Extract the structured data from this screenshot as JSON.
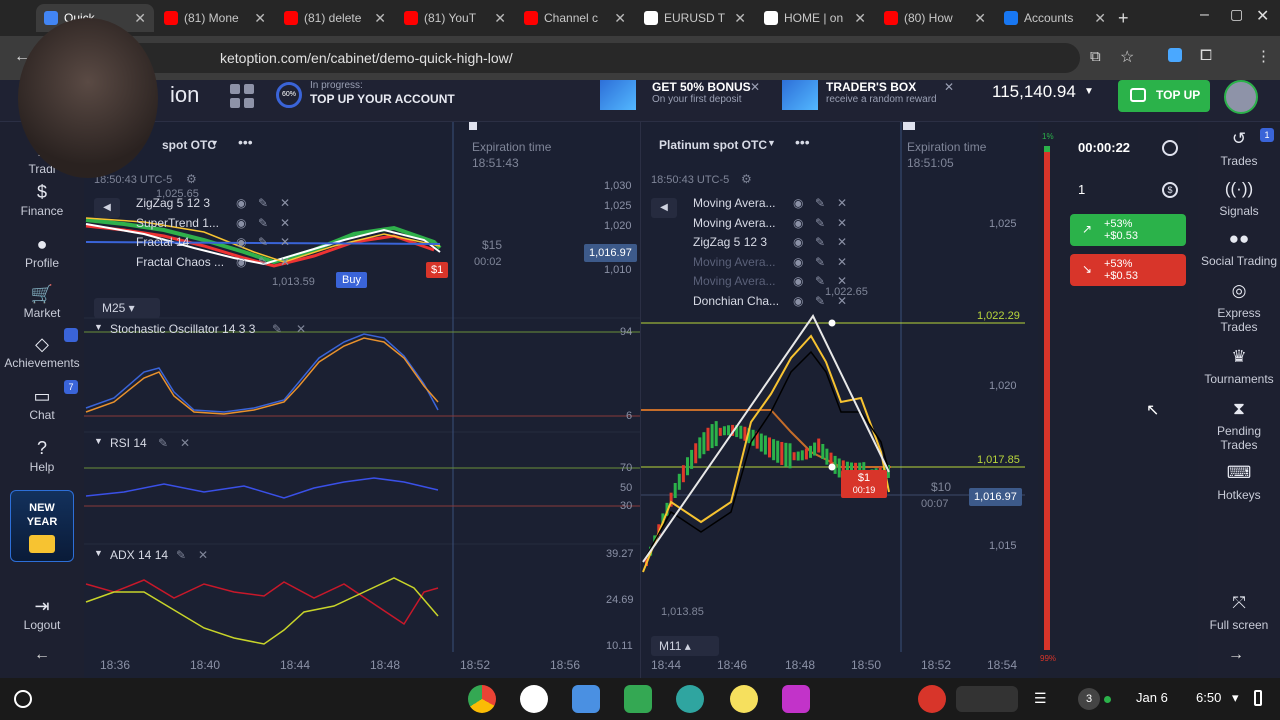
{
  "browser": {
    "tabs": [
      {
        "title": "Quick",
        "color": "#4285f4"
      },
      {
        "title": "(81) Mone",
        "color": "#ff0000"
      },
      {
        "title": "(81) delete",
        "color": "#ff0000"
      },
      {
        "title": "(81) YouT",
        "color": "#ff0000"
      },
      {
        "title": "Channel c",
        "color": "#ff0000"
      },
      {
        "title": "EURUSD T",
        "color": "#ffffff"
      },
      {
        "title": "HOME | on",
        "color": "#ffffff"
      },
      {
        "title": "(80) How",
        "color": "#ff0000"
      },
      {
        "title": "Accounts",
        "color": "#1877f2"
      }
    ],
    "url": "ketoption.com/en/cabinet/demo-quick-high-low/"
  },
  "header": {
    "logo_tail": "ion",
    "progress_pct": "60%",
    "progress_label": "In progress:",
    "progress_title": "TOP UP YOUR ACCOUNT",
    "promo1_title": "GET 50% BONUS",
    "promo1_sub": "On your first deposit",
    "promo2_title": "TRADER'S BOX",
    "promo2_sub": "receive a random reward",
    "balance": "115,140.94",
    "topup": "TOP UP"
  },
  "left_sidebar": {
    "items": [
      {
        "label": "Tradi",
        "icon": "trade-icon"
      },
      {
        "label": "Finance",
        "icon": "dollar-icon"
      },
      {
        "label": "Profile",
        "icon": "user-icon"
      },
      {
        "label": "Market",
        "icon": "cart-icon"
      },
      {
        "label": "Achievements",
        "icon": "diamond-icon"
      },
      {
        "label": "Chat",
        "icon": "chat-icon"
      },
      {
        "label": "Help",
        "icon": "help-icon"
      }
    ],
    "chat_badge": "7",
    "promo_line1": "NEW",
    "promo_line2": "YEAR",
    "logout": "Logout"
  },
  "chart_left": {
    "asset": "spot OTC",
    "time": "18:50:43 UTC-5",
    "exp_label": "Expiration time",
    "exp_time": "18:51:43",
    "indicators": [
      "ZigZag 5 12 3",
      "SuperTrend 1...",
      "Fractal 14",
      "Fractal Chaos ..."
    ],
    "price_axis": [
      "1,030",
      "1,025",
      "1,020",
      "1,010"
    ],
    "current_price": "1,016.97",
    "low_price": "1,013.59",
    "top_price": "1,025.65",
    "buy": "Buy",
    "trade_amount": "$15",
    "trade_timer": "00:02",
    "badge": "$1",
    "timeframe": "M25",
    "stoch_label": "Stochastic Oscillator 14 3 3",
    "stoch_axis": [
      "94",
      "6"
    ],
    "rsi_label": "RSI 14",
    "rsi_axis": [
      "70",
      "50",
      "30"
    ],
    "adx_label": "ADX 14 14",
    "adx_axis": [
      "39.27",
      "24.69",
      "10.11"
    ],
    "time_axis": [
      "18:36",
      "18:40",
      "18:44",
      "18:48",
      "18:52",
      "18:56"
    ]
  },
  "chart_right": {
    "asset": "Platinum spot OTC",
    "time": "18:50:43 UTC-5",
    "exp_label": "Expiration time",
    "exp_time": "18:51:05",
    "indicators": [
      "Moving Avera...",
      "Moving Avera...",
      "ZigZag 5 12 3",
      "Moving Avera...",
      "Moving Avera...",
      "Donchian Cha..."
    ],
    "price_axis": [
      "1,025",
      "1,020",
      "1,015"
    ],
    "high_line": "1,022.29",
    "high_label": "1,022.65",
    "mid_line": "1,017.85",
    "current_price": "1,016.97",
    "low_label": "1,013.85",
    "trade_amount": "$10",
    "trade_timer": "00:07",
    "badge": "$1",
    "badge_timer": "00:19",
    "timeframe": "M11",
    "time_axis": [
      "18:44",
      "18:46",
      "18:48",
      "18:50",
      "18:52",
      "18:54"
    ]
  },
  "trade_panel": {
    "timer": "00:00:22",
    "amount": "1",
    "up_pct": "+53%",
    "up_amt": "+$0.53",
    "down_pct": "+53%",
    "down_amt": "+$0.53",
    "sentiment_top": "1%",
    "sentiment_bottom": "99%"
  },
  "right_sidebar": {
    "items": [
      {
        "label": "Trades",
        "icon": "history-icon"
      },
      {
        "label": "Signals",
        "icon": "signal-icon"
      },
      {
        "label": "Social Trading",
        "icon": "people-icon"
      },
      {
        "label": "Express Trades",
        "icon": "target-icon"
      },
      {
        "label": "Tournaments",
        "icon": "trophy-icon"
      },
      {
        "label": "Pending Trades",
        "icon": "hourglass-icon"
      },
      {
        "label": "Hotkeys",
        "icon": "keyboard-icon"
      }
    ],
    "trades_badge": "1",
    "fullscreen": "Full screen"
  },
  "taskbar": {
    "date": "Jan 6",
    "time": "6:50",
    "notif": "3"
  }
}
